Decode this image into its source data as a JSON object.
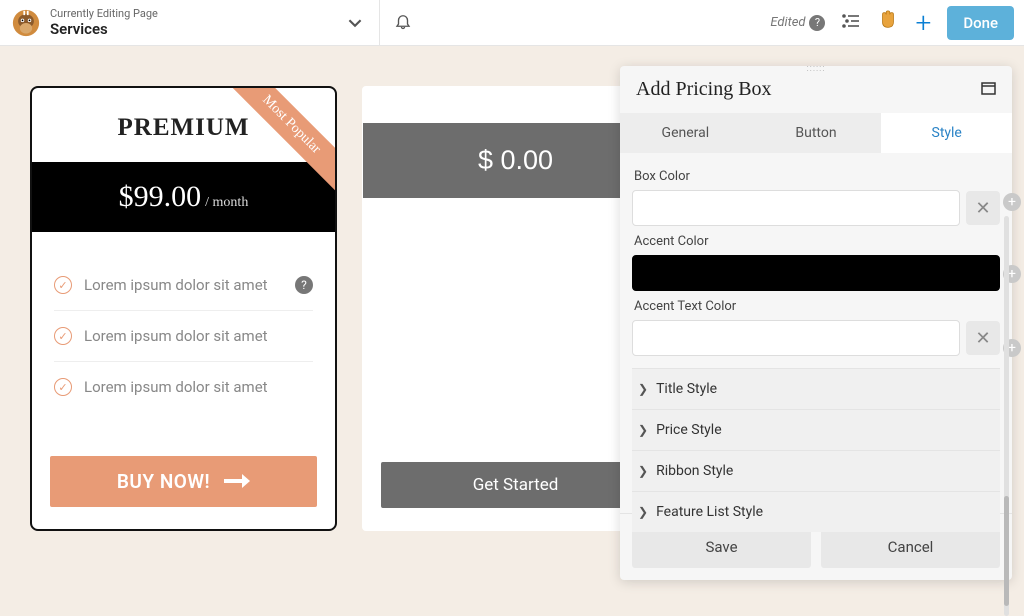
{
  "topbar": {
    "subtitle": "Currently Editing Page",
    "title": "Services",
    "edited_label": "Edited",
    "done_label": "Done"
  },
  "card1": {
    "title": "PREMIUM",
    "ribbon": "Most Popular",
    "price": "$99.00",
    "period": "/ month",
    "features": [
      "Lorem ipsum dolor sit amet",
      "Lorem ipsum dolor sit amet",
      "Lorem ipsum dolor sit amet"
    ],
    "cta": "BUY NOW!"
  },
  "card2": {
    "price": "$ 0.00",
    "cta": "Get Started"
  },
  "panel": {
    "title": "Add Pricing Box",
    "tabs": {
      "general": "General",
      "button": "Button",
      "style": "Style"
    },
    "fields": {
      "box_color": "Box Color",
      "accent_color": "Accent Color",
      "accent_text_color": "Accent Text Color"
    },
    "colors": {
      "box": "#ffffff",
      "accent": "#000000",
      "accent_text": "#ffffff"
    },
    "accordions": {
      "title_style": "Title Style",
      "price_style": "Price Style",
      "ribbon_style": "Ribbon Style",
      "feature_list_style": "Feature List Style"
    },
    "save": "Save",
    "cancel": "Cancel"
  }
}
